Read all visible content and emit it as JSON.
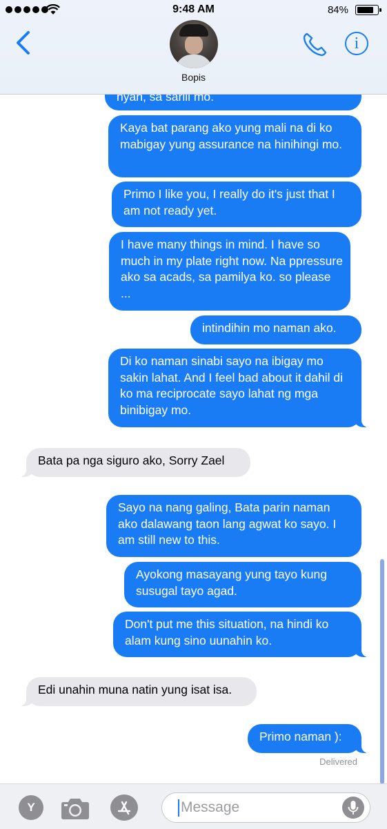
{
  "status_bar": {
    "time": "9:48 AM",
    "battery_percent": "84%",
    "battery_level": 0.84,
    "signal_bars": 5
  },
  "header": {
    "contact_name": "Bopis",
    "icons": [
      "back-chevron-icon",
      "phone-icon",
      "info-icon"
    ]
  },
  "messages": [
    {
      "direction": "outgoing",
      "text": "nyan, sa sarili mo."
    },
    {
      "direction": "outgoing",
      "text": "Kaya bat parang ako yung mali na di ko mabigay yung assurance na hinihingi mo."
    },
    {
      "direction": "outgoing",
      "text": "Primo I like you, I really do it's just that I am not ready yet."
    },
    {
      "direction": "outgoing",
      "text": "I have many things in mind. I have so much in my plate right now. Na ppressure ako sa acads, sa pamilya ko. so please ..."
    },
    {
      "direction": "outgoing",
      "text": "intindihin mo naman ako."
    },
    {
      "direction": "outgoing",
      "text": "Di ko naman sinabi sayo na ibigay mo sakin lahat. And I feel bad about it dahil di ko ma reciprocate sayo lahat ng mga binibigay mo."
    },
    {
      "direction": "incoming",
      "text": "Bata pa nga siguro ako, Sorry Zael"
    },
    {
      "direction": "outgoing",
      "text": "Sayo na nang galing, Bata parin naman ako dalawang taon lang agwat ko sayo. I am still new to this."
    },
    {
      "direction": "outgoing",
      "text": "Ayokong masayang yung tayo kung susugal tayo agad."
    },
    {
      "direction": "outgoing",
      "text": "Don't put me this situation, na hindi ko alam kung sino uunahin ko."
    },
    {
      "direction": "incoming",
      "text": "Edi unahin muna natin yung isat isa."
    },
    {
      "direction": "outgoing",
      "text": "Primo naman ):"
    }
  ],
  "delivery_status": "Delivered",
  "input_bar": {
    "app_icon_letter": "Y",
    "placeholder": "Message",
    "icons": [
      "camera-icon",
      "app-store-icon",
      "microphone-icon"
    ]
  },
  "colors": {
    "outgoing_bubble": "#1a7cf5",
    "incoming_bubble": "#e8e8ec",
    "accent": "#1a7cf5"
  }
}
